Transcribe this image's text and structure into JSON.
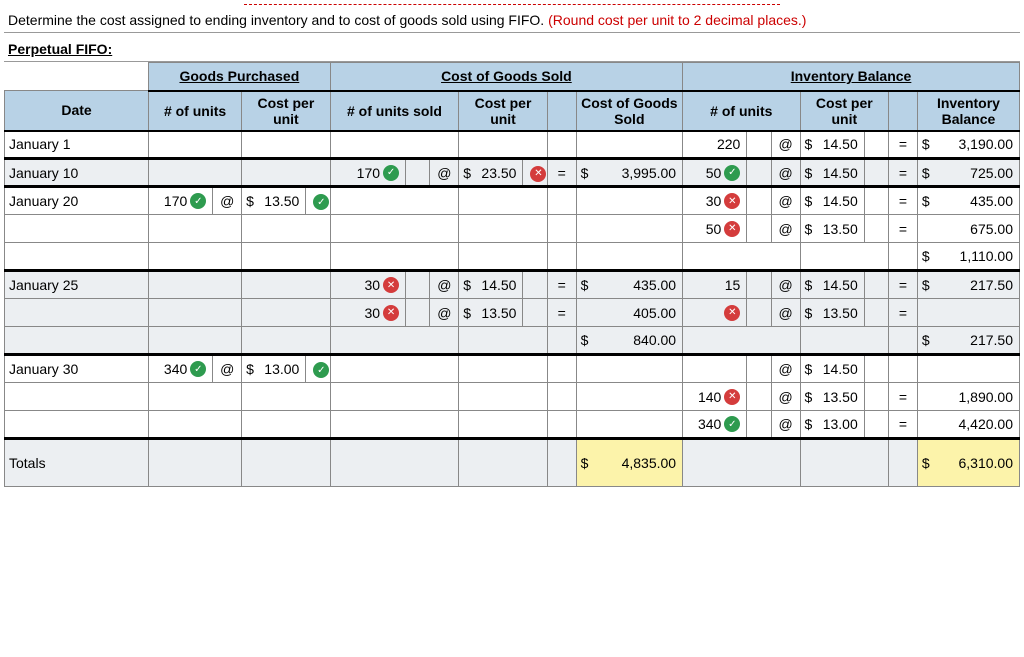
{
  "instruction_main": "Determine the cost assigned to ending inventory and to cost of goods sold using FIFO. ",
  "instruction_note": "(Round cost per unit to 2 decimal places.)",
  "subtitle": "Perpetual FIFO:",
  "headers": {
    "goods": "Goods Purchased",
    "cogs": "Cost of Goods Sold",
    "inv": "Inventory Balance",
    "date": "Date",
    "units": "# of units",
    "cpu": "Cost per unit",
    "units_sold": "# of units sold",
    "cogs_amt": "Cost of Goods Sold",
    "inv_units": "# of units",
    "inv_bal": "Inventory Balance"
  },
  "rows": {
    "jan1": {
      "date": "January 1",
      "inv_units": "220",
      "inv_cpu": "14.50",
      "inv_bal": "3,190.00"
    },
    "jan10": {
      "date": "January 10",
      "sold_units": "170",
      "sold_cpu": "23.50",
      "cogs": "3,995.00",
      "inv_units": "50",
      "inv_cpu": "14.50",
      "inv_bal": "725.00"
    },
    "jan20": {
      "date": "January 20",
      "buy_units": "170",
      "buy_cpu": "13.50",
      "inv1_units": "30",
      "inv1_cpu": "14.50",
      "inv1_bal": "435.00",
      "inv2_units": "50",
      "inv2_cpu": "13.50",
      "inv2_bal": "675.00",
      "inv_sub": "1,110.00"
    },
    "jan25": {
      "date": "January 25",
      "s1_units": "30",
      "s1_cpu": "14.50",
      "s1_amt": "435.00",
      "s2_units": "30",
      "s2_cpu": "13.50",
      "s2_amt": "405.00",
      "cogs_sub": "840.00",
      "inv1_units": "15",
      "inv1_cpu": "14.50",
      "inv1_bal": "217.50",
      "inv2_cpu": "13.50",
      "inv_sub": "217.50"
    },
    "jan30": {
      "date": "January 30",
      "buy_units": "340",
      "buy_cpu": "13.00",
      "inv1_cpu": "14.50",
      "inv2_units": "140",
      "inv2_cpu": "13.50",
      "inv2_bal": "1,890.00",
      "inv3_units": "340",
      "inv3_cpu": "13.00",
      "inv3_bal": "4,420.00"
    },
    "totals": {
      "date": "Totals",
      "cogs": "4,835.00",
      "inv": "6,310.00"
    }
  },
  "symbols": {
    "at": "@",
    "eq": "=",
    "dollar": "$"
  }
}
